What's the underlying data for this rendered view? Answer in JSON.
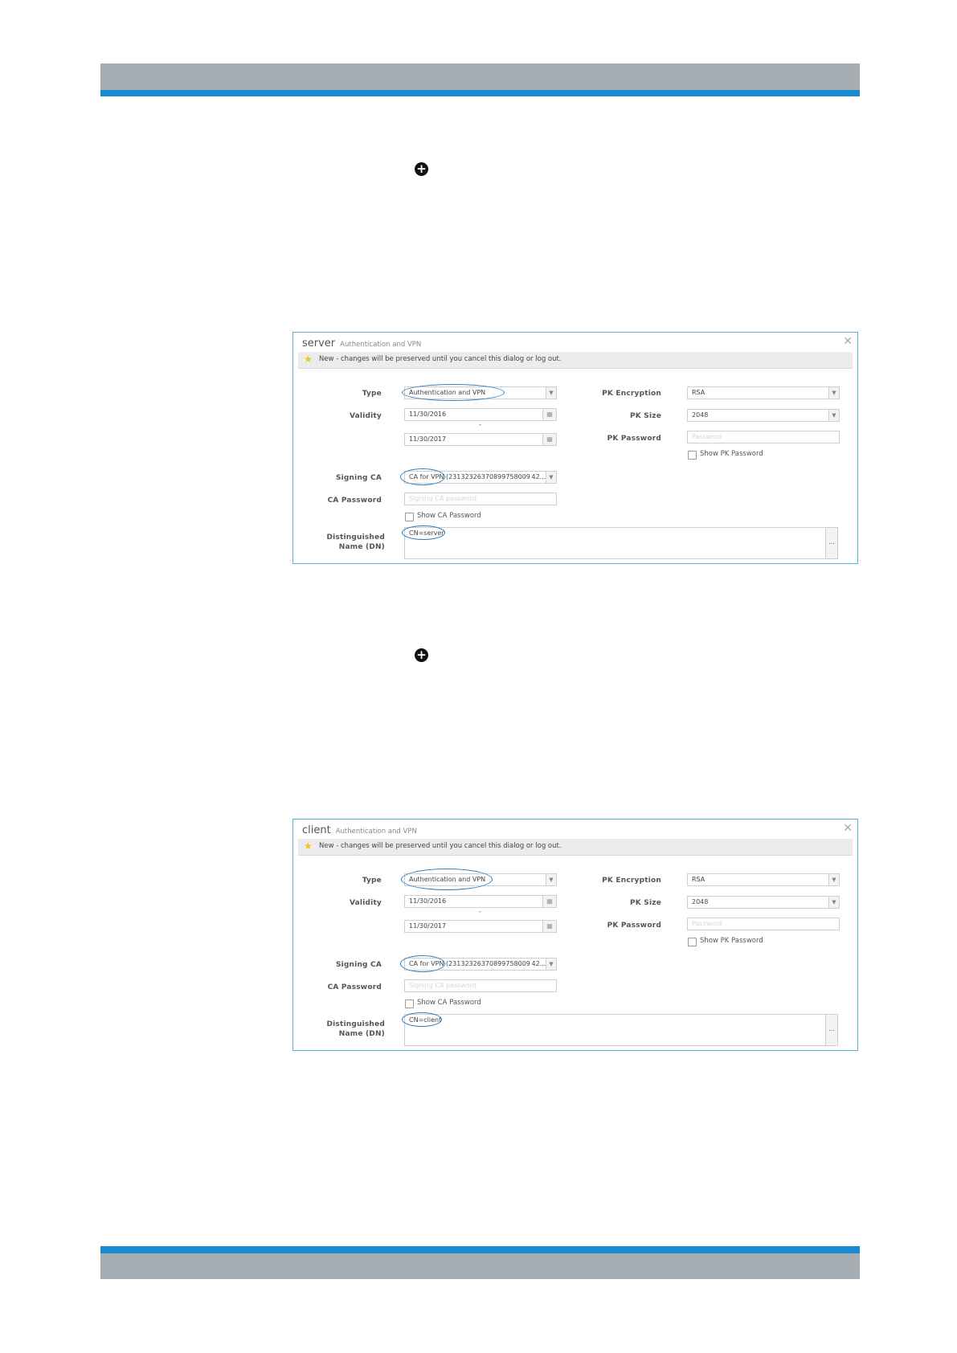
{
  "colors": {
    "header_gray": "#a5adb3",
    "header_blue": "#1a8ad0",
    "dialog_border": "#5ab2e0",
    "annotation_ellipse": "#2a7ec2"
  },
  "icons": {
    "add": "plus-circle-icon",
    "close": "close-icon",
    "new_marker": "star-icon",
    "calendar": "calendar-icon",
    "dropdown": "chevron-down-icon"
  },
  "dialogs": [
    {
      "title": "server",
      "subtitle": "Authentication and VPN",
      "notice": "New - changes will be preserved until you cancel this dialog or log out.",
      "type_label": "Type",
      "type_value": "Authentication and VPN",
      "validity_label": "Validity",
      "validity_from": "11/30/2016",
      "validity_separator": "-",
      "validity_to": "11/30/2017",
      "signing_ca_label": "Signing CA",
      "signing_ca_value": "CA for VPN (23132326370899758009 42...",
      "ca_password_label": "CA Password",
      "ca_password_placeholder": "Signing CA password",
      "show_ca_password_label": "Show CA Password",
      "dn_label_line1": "Distinguished",
      "dn_label_line2": "Name (DN)",
      "dn_value": "CN=server",
      "dn_button": "...",
      "pk_encryption_label": "PK Encryption",
      "pk_encryption_value": "RSA",
      "pk_size_label": "PK Size",
      "pk_size_value": "2048",
      "pk_password_label": "PK Password",
      "pk_password_placeholder": "Password",
      "show_pk_password_label": "Show PK Password"
    },
    {
      "title": "client",
      "subtitle": "Authentication and VPN",
      "notice": "New - changes will be preserved until you cancel this dialog or log out.",
      "type_label": "Type",
      "type_value": "Authentication and VPN",
      "validity_label": "Validity",
      "validity_from": "11/30/2016",
      "validity_separator": "-",
      "validity_to": "11/30/2017",
      "signing_ca_label": "Signing CA",
      "signing_ca_value": "CA for VPN (23132326370899758009 42...",
      "ca_password_label": "CA Password",
      "ca_password_placeholder": "Signing CA password",
      "show_ca_password_label": "Show CA Password",
      "dn_label_line1": "Distinguished",
      "dn_label_line2": "Name (DN)",
      "dn_value": "CN=client",
      "dn_button": "...",
      "pk_encryption_label": "PK Encryption",
      "pk_encryption_value": "RSA",
      "pk_size_label": "PK Size",
      "pk_size_value": "2048",
      "pk_password_label": "PK Password",
      "pk_password_placeholder": "Password",
      "show_pk_password_label": "Show PK Password"
    }
  ]
}
